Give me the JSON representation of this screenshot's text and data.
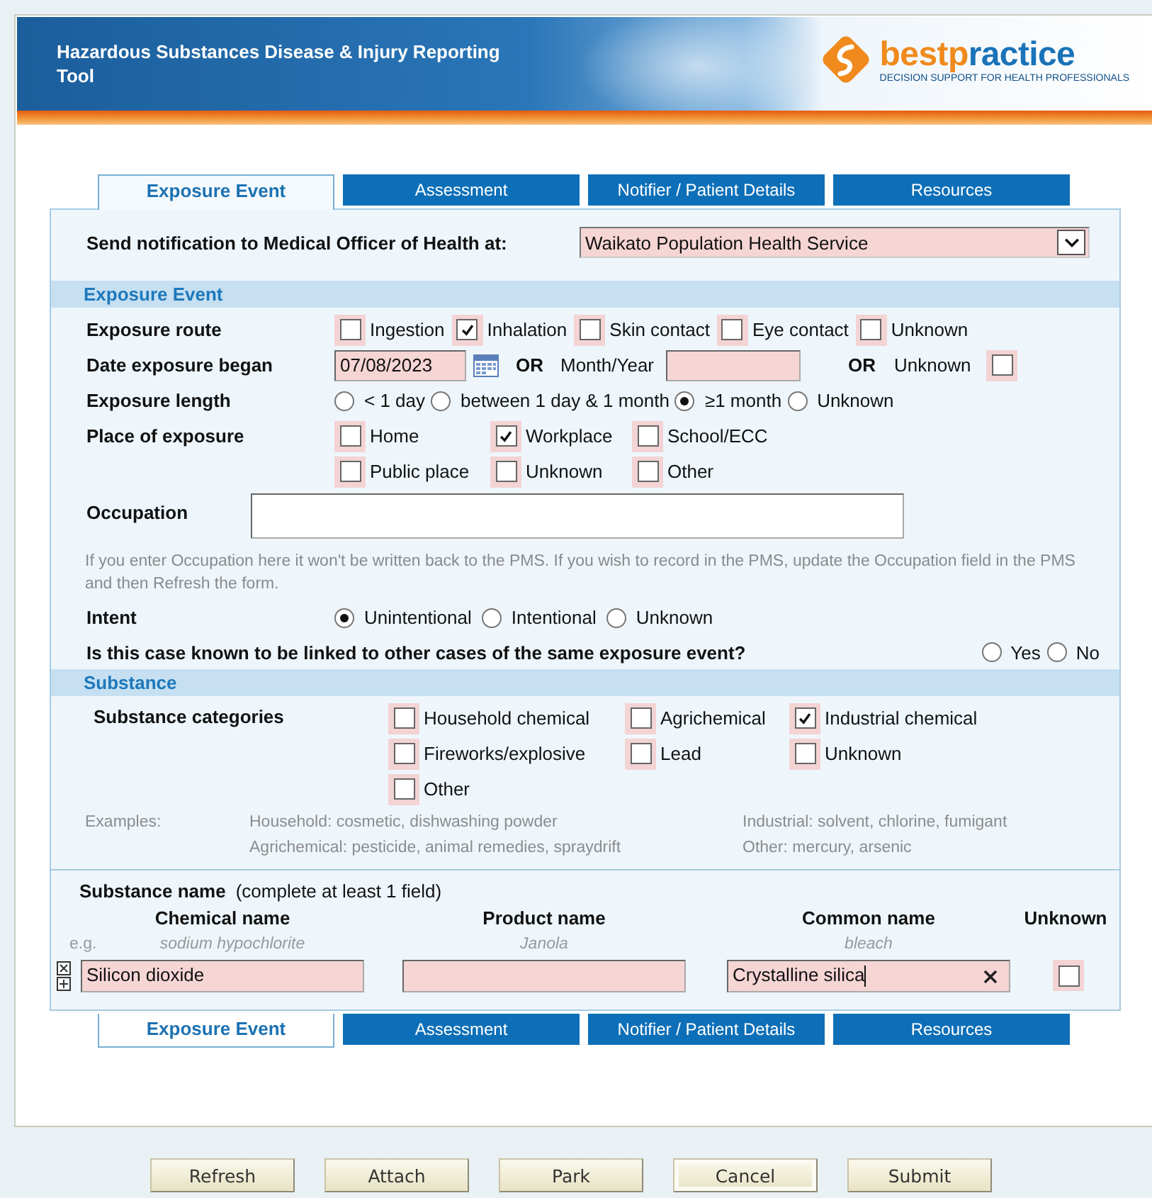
{
  "header": {
    "title": "Hazardous Substances Disease & Injury Reporting Tool",
    "logo": {
      "wordmark": [
        {
          "text": "bestp",
          "color": "#f08a1c"
        },
        {
          "text": "ractice",
          "color": "#1a73b8"
        }
      ],
      "tagline": "DECISION SUPPORT FOR HEALTH PROFESSIONALS"
    }
  },
  "tabs_top": [
    {
      "label": "Exposure Event",
      "selected": true
    },
    {
      "label": "Assessment",
      "selected": false
    },
    {
      "label": "Notifier / Patient Details",
      "selected": false
    },
    {
      "label": "Resources",
      "selected": false
    }
  ],
  "notify": {
    "label": "Send notification to Medical Officer of Health at:",
    "value": "Waikato Population Health Service"
  },
  "exposure_event": {
    "title": "Exposure Event",
    "route": {
      "label": "Exposure route",
      "options": [
        {
          "label": "Ingestion",
          "checked": false
        },
        {
          "label": "Inhalation",
          "checked": true
        },
        {
          "label": "Skin contact",
          "checked": false
        },
        {
          "label": "Eye contact",
          "checked": false
        },
        {
          "label": "Unknown",
          "checked": false
        }
      ]
    },
    "date": {
      "label": "Date exposure began",
      "value": "07/08/2023",
      "or_1": "OR",
      "month_label": "Month/Year",
      "or_2": "OR",
      "unknown_label": "Unknown",
      "unknown_checked": false
    },
    "length": {
      "label": "Exposure length",
      "options": [
        {
          "label": "< 1 day",
          "selected": false
        },
        {
          "label": "between 1 day & 1 month",
          "selected": false
        },
        {
          "label": "≥1 month",
          "selected": true
        },
        {
          "label": "Unknown",
          "selected": false
        }
      ]
    },
    "place": {
      "label": "Place of exposure",
      "options": [
        {
          "label": "Home",
          "checked": false
        },
        {
          "label": "Workplace",
          "checked": true
        },
        {
          "label": "School/ECC",
          "checked": false
        },
        {
          "label": "Public place",
          "checked": false
        },
        {
          "label": "Unknown",
          "checked": false
        },
        {
          "label": "Other",
          "checked": false
        }
      ]
    },
    "occupation": {
      "label": "Occupation",
      "note": "If you enter Occupation here it won't be written back to the PMS. If you wish to record in the PMS, update the Occupation field in the PMS and then Refresh the form."
    },
    "intent": {
      "label": "Intent",
      "options": [
        {
          "label": "Unintentional",
          "selected": true
        },
        {
          "label": "Intentional",
          "selected": false
        },
        {
          "label": "Unknown",
          "selected": false
        }
      ]
    },
    "linked": {
      "question": "Is this case known to be linked to other cases of the same exposure event?",
      "options": [
        {
          "label": "Yes",
          "selected": false
        },
        {
          "label": "No",
          "selected": false
        }
      ]
    }
  },
  "substance": {
    "title": "Substance",
    "categories": {
      "label": "Substance categories",
      "options": [
        {
          "label": "Household chemical",
          "checked": false
        },
        {
          "label": "Agrichemical",
          "checked": false
        },
        {
          "label": "Industrial chemical",
          "checked": true
        },
        {
          "label": "Fireworks/explosive",
          "checked": false
        },
        {
          "label": "Lead",
          "checked": false
        },
        {
          "label": "Unknown",
          "checked": false
        },
        {
          "label": "Other",
          "checked": false
        }
      ]
    },
    "examples": {
      "label": "Examples:",
      "items": [
        "Household: cosmetic, dishwashing powder",
        "Industrial: solvent, chlorine, fumigant",
        "Agrichemical: pesticide, animal remedies, spraydrift",
        "Other: mercury, arsenic"
      ]
    },
    "name": {
      "label": "Substance name",
      "hint": "(complete at least 1 field)",
      "eg_label": "e.g.",
      "fields": [
        {
          "heading": "Chemical name",
          "example": "sodium hypochlorite",
          "value": "Silicon dioxide",
          "clearable": false
        },
        {
          "heading": "Product name",
          "example": "Janola",
          "clearable": false
        },
        {
          "heading": "Common name",
          "example": "bleach",
          "value": "Crystalline silica",
          "clearable": true
        }
      ],
      "unknown": {
        "heading": "Unknown",
        "checked": false
      }
    }
  },
  "tabs_bottom": [
    {
      "label": "Exposure Event",
      "selected": true
    },
    {
      "label": "Assessment",
      "selected": false
    },
    {
      "label": "Notifier / Patient Details",
      "selected": false
    },
    {
      "label": "Resources",
      "selected": false
    }
  ],
  "buttons": [
    {
      "label": "Refresh",
      "focused": false
    },
    {
      "label": "Attach",
      "focused": false
    },
    {
      "label": "Park",
      "focused": false
    },
    {
      "label": "Cancel",
      "focused": true
    },
    {
      "label": "Submit",
      "focused": false
    }
  ]
}
